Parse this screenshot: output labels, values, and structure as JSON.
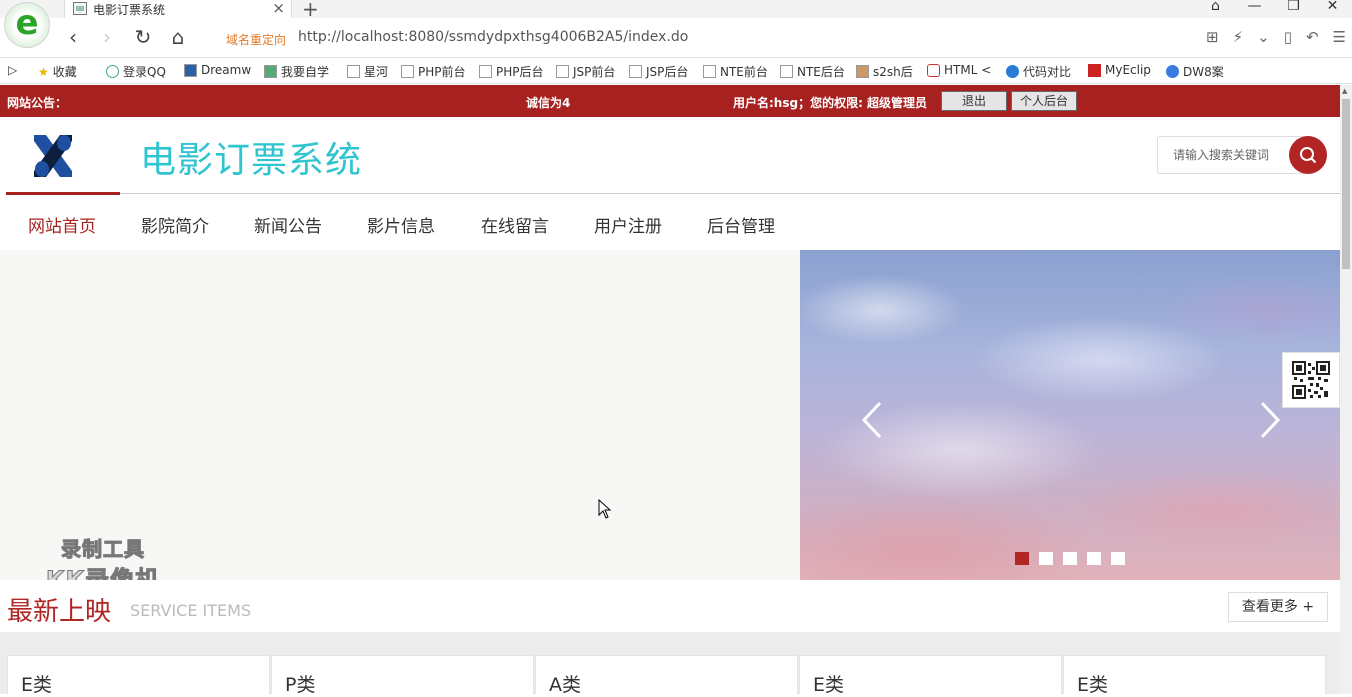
{
  "browser": {
    "tab_title": "电影订票系统",
    "redirect_label": "域名重定向",
    "url": "http://localhost:8080/ssmdydpxthsg4006B2A5/index.do",
    "bookmarks": [
      "收藏",
      "登录QQ",
      "Dreamw",
      "我要自学",
      "星河",
      "PHP前台",
      "PHP后台",
      "JSP前台",
      "JSP后台",
      "NTE前台",
      "NTE后台",
      "s2sh后",
      "HTML <",
      "代码对比",
      "MyEclip",
      "DW8案"
    ]
  },
  "topbar": {
    "notice_label": "网站公告：",
    "slogan": "诚信为4",
    "user_info": "用户名:hsg；您的权限: 超级管理员",
    "logout_label": "退出",
    "admin_label": "个人后台"
  },
  "header": {
    "site_title": "电影订票系统",
    "search_placeholder": "请输入搜索关键词"
  },
  "menu": [
    "网站首页",
    "影院简介",
    "新闻公告",
    "影片信息",
    "在线留言",
    "用户注册",
    "后台管理"
  ],
  "menu_active_index": 0,
  "watermark": {
    "line1": "录制工具",
    "line2": "KK录像机"
  },
  "section": {
    "title": "最新上映",
    "subtitle": "SERVICE ITEMS",
    "more_label": "查看更多 +"
  },
  "categories": [
    "E类",
    "P类",
    "A类",
    "E类",
    "E类"
  ],
  "banner": {
    "slide_count": 5,
    "active_slide": 0
  },
  "colors": {
    "brand_red": "#a82121",
    "title_cyan": "#2ec4d0"
  }
}
